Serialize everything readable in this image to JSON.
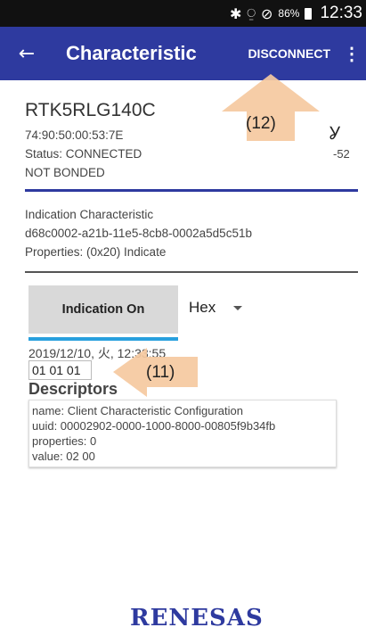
{
  "status_bar": {
    "icons": [
      "bluetooth-icon",
      "vibrate-mute-icon",
      "do-not-disturb-icon",
      "battery-icon"
    ],
    "battery": "86%",
    "time": "12:33"
  },
  "app_bar": {
    "title": "Characteristic",
    "disconnect_label": "DISCONNECT",
    "back_icon": "←",
    "overflow_icon": "⋮",
    "color": "#2e3a9f"
  },
  "device": {
    "name": "RTK5RLG140C",
    "address": "74:90:50:00:53:7E",
    "status": "Status:  CONNECTED",
    "bond": "NOT BONDED",
    "rssi": "-52",
    "signal_icon": "signal-strength-icon"
  },
  "characteristic": {
    "name": "Indication Characteristic",
    "uuid": "d68c0002-a21b-11e5-8cb8-0002a5d5c51b",
    "properties": "Properties: (0x20) Indicate"
  },
  "controls": {
    "indication_button": "Indication On",
    "format_selected": "Hex"
  },
  "value": {
    "timestamp": "2019/12/10, 火, 12:33:55",
    "data": "01 01 01"
  },
  "descriptors": {
    "heading": "Descriptors",
    "items": [
      {
        "name": "name: Client Characteristic Configuration",
        "uuid": "uuid: 00002902-0000-1000-8000-00805f9b34fb",
        "properties": "properties: 0",
        "value": "value: 02 00"
      }
    ]
  },
  "annotations": {
    "callout_12": "(12)",
    "callout_11": "(11)",
    "callout_color": "#f5c9a0"
  },
  "footer": {
    "logo": "RENESAS"
  }
}
